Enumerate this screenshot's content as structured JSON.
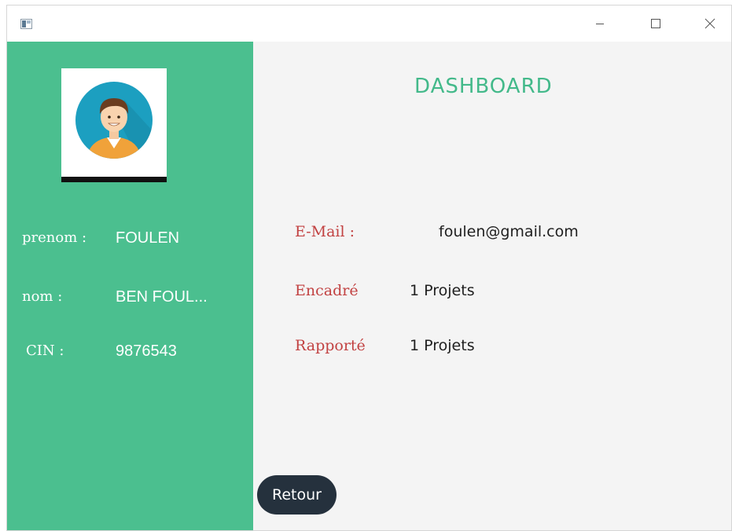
{
  "window": {
    "icon": "app-window-icon",
    "controls": [
      "minimize-icon",
      "maximize-icon",
      "close-icon"
    ]
  },
  "sidebar": {
    "background": "#4bbf8f",
    "avatar": "user-avatar-icon",
    "prenom": {
      "label": "prenom :",
      "value": "FOULEN"
    },
    "nom": {
      "label": "nom :",
      "value": "BEN FOUL..."
    },
    "cin": {
      "label": "CIN :",
      "value": "9876543"
    }
  },
  "main": {
    "title": "DASHBOARD",
    "title_color": "#43b98a",
    "label_color": "#c24242",
    "email": {
      "label": "E-Mail :",
      "value": "foulen@gmail.com"
    },
    "encadre": {
      "label": "Encadré",
      "value": "1 Projets"
    },
    "rapporte": {
      "label": "Rapporté",
      "value": "1 Projets"
    },
    "back_button": {
      "label": "Retour",
      "color": "#25313d"
    }
  }
}
